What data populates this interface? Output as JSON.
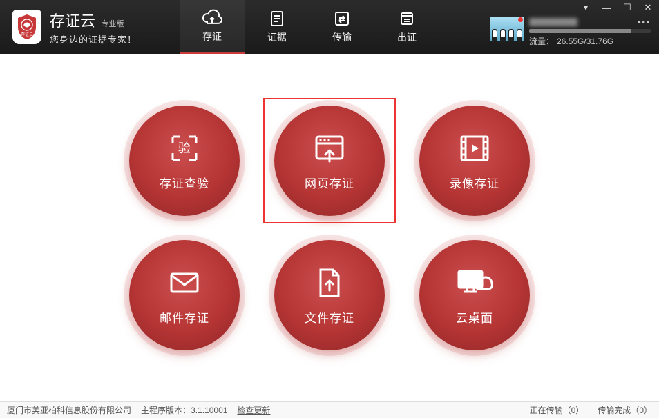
{
  "app": {
    "title": "存证云",
    "edition": "专业版",
    "tagline": "您身边的证据专家！"
  },
  "nav": [
    {
      "label": "存证",
      "active": true
    },
    {
      "label": "证据",
      "active": false
    },
    {
      "label": "传输",
      "active": false
    },
    {
      "label": "出证",
      "active": false
    }
  ],
  "user": {
    "traffic_label": "流量：",
    "traffic_value": "26.55G/31.76G",
    "menu_glyph": "•••"
  },
  "buttons": [
    {
      "key": "verify",
      "label": "存证查验",
      "selected": false
    },
    {
      "key": "web",
      "label": "网页存证",
      "selected": true
    },
    {
      "key": "video",
      "label": "录像存证",
      "selected": false
    },
    {
      "key": "mail",
      "label": "邮件存证",
      "selected": false
    },
    {
      "key": "file",
      "label": "文件存证",
      "selected": false
    },
    {
      "key": "cloud",
      "label": "云桌面",
      "selected": false
    }
  ],
  "footer": {
    "company": "厦门市美亚柏科信息股份有限公司",
    "version_label": "主程序版本：",
    "version_value": "3.1.10001",
    "update_link": "检查更新",
    "uploading_label": "正在传输",
    "uploading_count": "（0）",
    "done_label": "传输完成",
    "done_count": "（0）"
  }
}
